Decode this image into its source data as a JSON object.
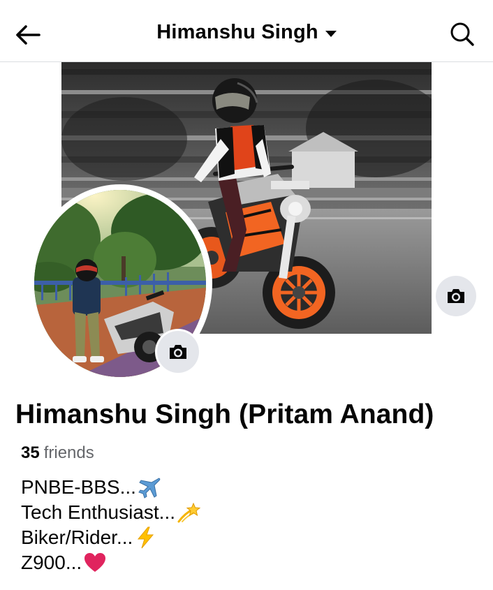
{
  "header": {
    "title": "Himanshu Singh",
    "back_icon": "arrow-left-icon",
    "dropdown_icon": "caret-down-icon",
    "search_icon": "search-icon"
  },
  "profile": {
    "name": "Himanshu Singh (Pritam Anand)",
    "friends_count": "35",
    "friends_label": "friends",
    "bio_lines": [
      {
        "text": "PNBE-BBS...",
        "emoji": "airplane-emoji"
      },
      {
        "text": "Tech Enthusiast...",
        "emoji": "dizzy-star-emoji"
      },
      {
        "text": "Biker/Rider...",
        "emoji": "lightning-emoji"
      },
      {
        "text": "Z900...",
        "emoji": "red-heart-emoji"
      }
    ]
  },
  "buttons": {
    "cover_camera_icon": "camera-icon",
    "avatar_camera_icon": "camera-icon"
  },
  "colors": {
    "text_primary": "#050505",
    "text_secondary": "#65676b",
    "button_bg": "#e4e6eb",
    "divider": "#dadde1",
    "bike_orange": "#f26522",
    "heart_red": "#e0245e"
  }
}
